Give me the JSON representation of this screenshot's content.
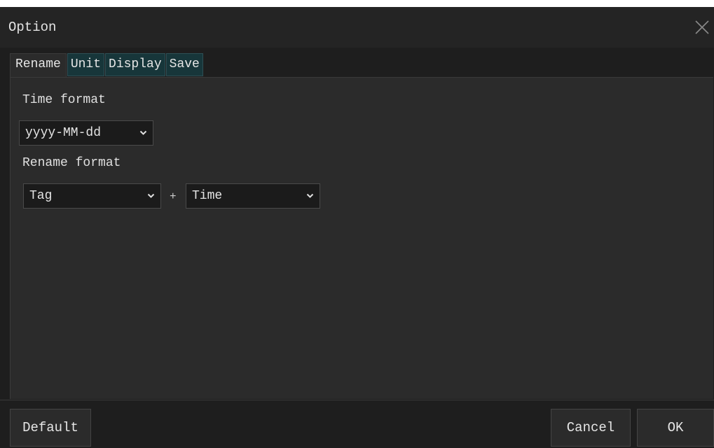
{
  "window": {
    "title": "Option",
    "close_icon": "close-icon"
  },
  "tabs": [
    {
      "label": "Rename",
      "active": true
    },
    {
      "label": "Unit",
      "active": false
    },
    {
      "label": "Display",
      "active": false
    },
    {
      "label": "Save",
      "active": false
    }
  ],
  "rename": {
    "time_format_label": "Time format",
    "time_format_value": "yyyy-MM-dd",
    "rename_format_label": "Rename format",
    "first_field_value": "Tag",
    "joiner": "+",
    "second_field_value": "Time"
  },
  "buttons": {
    "default_label": "Default",
    "cancel_label": "Cancel",
    "ok_label": "OK"
  },
  "colors": {
    "background": "#1e1e1e",
    "panel": "#2b2b2b",
    "inactive_tab": "#17363a",
    "text": "#e4e4e4"
  }
}
